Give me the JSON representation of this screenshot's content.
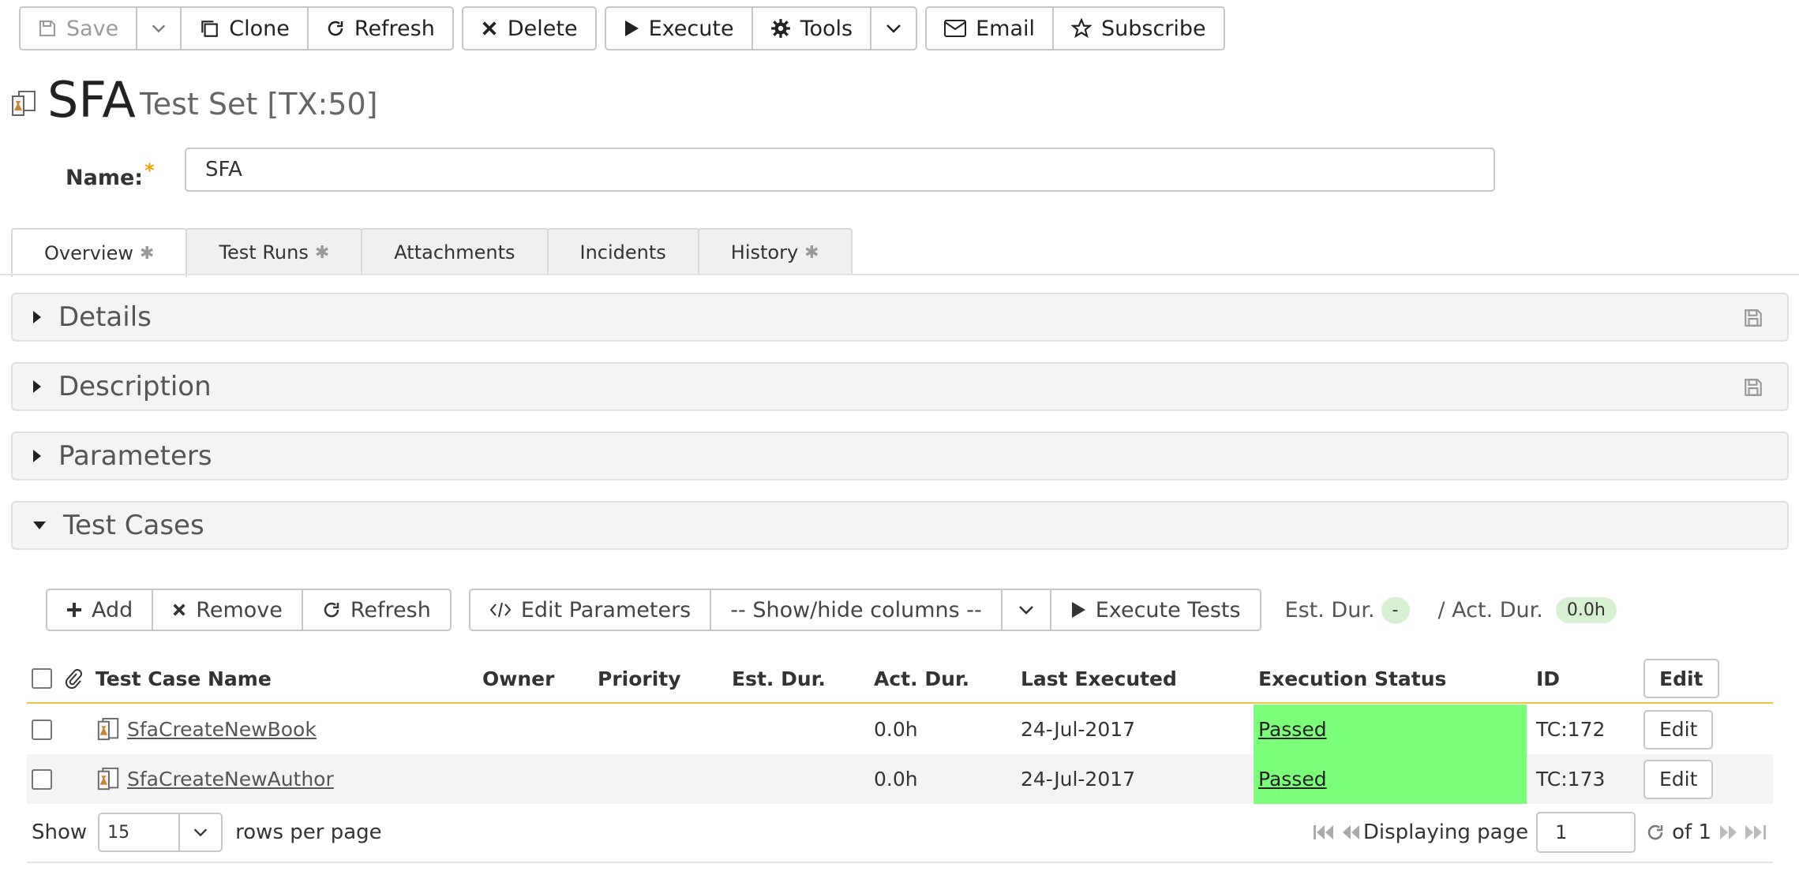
{
  "toolbar": {
    "save": "Save",
    "clone": "Clone",
    "refresh": "Refresh",
    "delete": "Delete",
    "execute": "Execute",
    "tools": "Tools",
    "email": "Email",
    "subscribe": "Subscribe"
  },
  "title": {
    "name": "SFA",
    "subtitle": "Test Set [TX:50]"
  },
  "name_field": {
    "label": "Name:",
    "required_mark": "*",
    "value": "SFA"
  },
  "tabs": [
    {
      "label": "Overview",
      "marker": "✱",
      "active": true
    },
    {
      "label": "Test Runs",
      "marker": "✱"
    },
    {
      "label": "Attachments"
    },
    {
      "label": "Incidents"
    },
    {
      "label": "History",
      "marker": "✱"
    }
  ],
  "panels": {
    "details": "Details",
    "description": "Description",
    "parameters": "Parameters",
    "test_cases": "Test Cases"
  },
  "tc_toolbar": {
    "add": "Add",
    "remove": "Remove",
    "refresh": "Refresh",
    "edit_parameters": "Edit Parameters",
    "show_hide": "-- Show/hide columns --",
    "execute_tests": "Execute Tests",
    "est_dur_label": "Est. Dur.",
    "est_dur_value": "-",
    "act_dur_label": "/ Act. Dur.",
    "act_dur_value": "0.0h"
  },
  "table": {
    "headers": {
      "name": "Test Case Name",
      "owner": "Owner",
      "priority": "Priority",
      "est_dur": "Est. Dur.",
      "act_dur": "Act. Dur.",
      "last_executed": "Last Executed",
      "status": "Execution Status",
      "id": "ID",
      "edit": "Edit"
    },
    "rows": [
      {
        "name": "SfaCreateNewBook",
        "owner": "",
        "priority": "",
        "est_dur": "",
        "act_dur": "0.0h",
        "last_executed": "24-Jul-2017",
        "status": "Passed",
        "id": "TC:172",
        "edit": "Edit"
      },
      {
        "name": "SfaCreateNewAuthor",
        "owner": "",
        "priority": "",
        "est_dur": "",
        "act_dur": "0.0h",
        "last_executed": "24-Jul-2017",
        "status": "Passed",
        "id": "TC:173",
        "edit": "Edit"
      }
    ]
  },
  "pager": {
    "show": "Show",
    "rows_value": "15",
    "rows_per_page": "rows per page",
    "displaying_page": "Displaying page",
    "page_value": "1",
    "of_total": "of 1"
  },
  "colors": {
    "passed": "#7bff7b",
    "header_rule": "#f0c24a",
    "required": "#f0a20c"
  }
}
